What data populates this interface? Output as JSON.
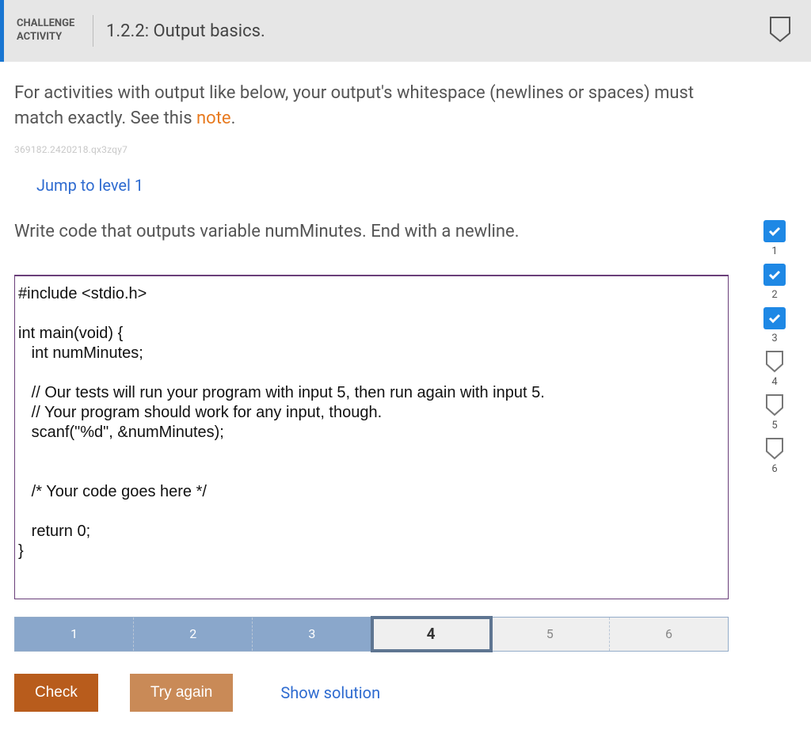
{
  "header": {
    "label_line1": "CHALLENGE",
    "label_line2": "ACTIVITY",
    "title": "1.2.2: Output basics."
  },
  "intro": {
    "text_part1": "For activities with output like below, your output's whitespace (newlines or spaces) must match exactly. See this ",
    "link_text": "note",
    "text_part2": "."
  },
  "id_string": "369182.2420218.qx3zqy7",
  "jump_link": "Jump to level 1",
  "prompt": "Write code that outputs variable numMinutes. End with a newline.",
  "code": "#include <stdio.h>\n\nint main(void) {\n   int numMinutes;\n\n   // Our tests will run your program with input 5, then run again with input 5.\n   // Your program should work for any input, though.\n   scanf(\"%d\", &numMinutes);\n\n\n   /* Your code goes here */\n\n   return 0;\n}",
  "levels": [
    {
      "num": "1",
      "state": "done"
    },
    {
      "num": "2",
      "state": "done"
    },
    {
      "num": "3",
      "state": "done"
    },
    {
      "num": "4",
      "state": "current"
    },
    {
      "num": "5",
      "state": "future"
    },
    {
      "num": "6",
      "state": "future"
    }
  ],
  "buttons": {
    "check": "Check",
    "try_again": "Try again",
    "show_solution": "Show solution"
  },
  "side_track": [
    {
      "num": "1",
      "state": "done"
    },
    {
      "num": "2",
      "state": "done"
    },
    {
      "num": "3",
      "state": "done"
    },
    {
      "num": "4",
      "state": "pocket"
    },
    {
      "num": "5",
      "state": "pocket"
    },
    {
      "num": "6",
      "state": "pocket"
    }
  ]
}
